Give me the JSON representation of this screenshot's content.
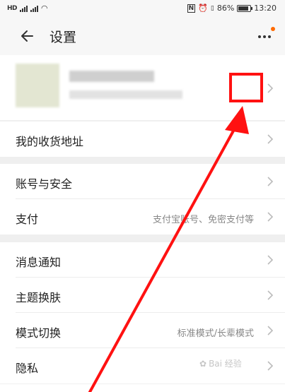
{
  "status_bar": {
    "sim": "HD",
    "signal_label": "4G",
    "battery_percent": "86%",
    "battery_level": 0.86,
    "time": "13:20"
  },
  "header": {
    "back_icon": "arrow-left-icon",
    "title": "设置",
    "more_icon": "more-dots-icon",
    "notify_color": "#ff6a00"
  },
  "rows": {
    "address": {
      "label": "我的收货地址"
    },
    "account_security": {
      "label": "账号与安全"
    },
    "payment": {
      "label": "支付",
      "value": "支付宝账号、免密支付等"
    },
    "notifications": {
      "label": "消息通知"
    },
    "theme": {
      "label": "主题换肤"
    },
    "mode_switch": {
      "label": "模式切换",
      "value": "标准模式/长辈模式"
    },
    "privacy": {
      "label": "隐私"
    }
  },
  "annotation": {
    "color": "#ff1111"
  },
  "watermark": {
    "text": "Bai 经验"
  }
}
